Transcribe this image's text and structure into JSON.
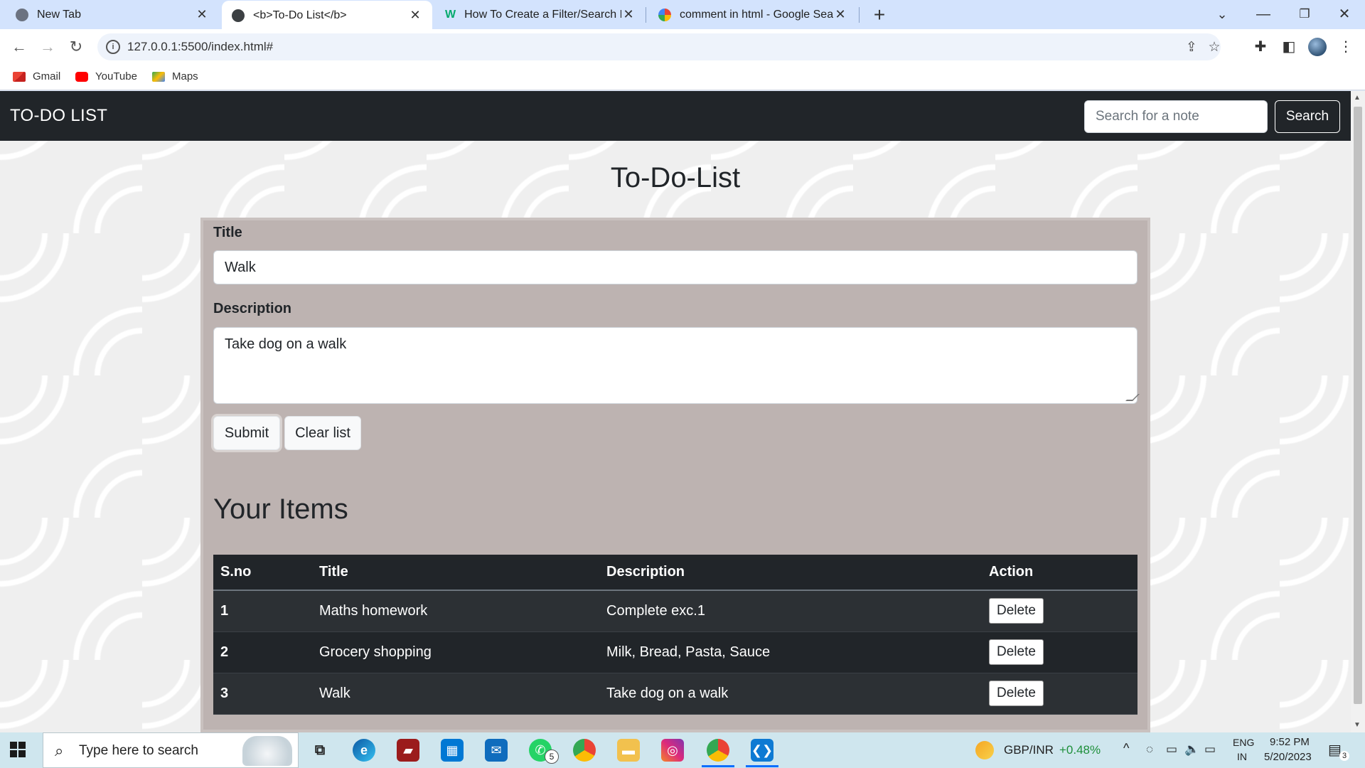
{
  "browser": {
    "tabs": [
      {
        "title": "New Tab",
        "active": false
      },
      {
        "title": "<b>To-Do List</b>",
        "active": true
      },
      {
        "title": "How To Create a Filter/Search Lis",
        "active": false
      },
      {
        "title": "comment in html - Google Searc",
        "active": false
      }
    ],
    "url": "127.0.0.1:5500/index.html#",
    "bookmarks": [
      "Gmail",
      "YouTube",
      "Maps"
    ]
  },
  "navbar": {
    "brand": "TO-DO LIST",
    "search_placeholder": "Search for a note",
    "search_button": "Search"
  },
  "main": {
    "heading": "To-Do-List",
    "title_label": "Title",
    "title_value": "Walk",
    "description_label": "Description",
    "description_value": "Take dog on a walk",
    "submit_label": "Submit",
    "clear_label": "Clear list",
    "items_heading": "Your Items"
  },
  "table": {
    "headers": [
      "S.no",
      "Title",
      "Description",
      "Action"
    ],
    "rows": [
      {
        "sno": "1",
        "title": "Maths homework",
        "description": "Complete exc.1",
        "action": "Delete"
      },
      {
        "sno": "2",
        "title": "Grocery shopping",
        "description": "Milk, Bread, Pasta, Sauce",
        "action": "Delete"
      },
      {
        "sno": "3",
        "title": "Walk",
        "description": "Take dog on a walk",
        "action": "Delete"
      }
    ]
  },
  "taskbar": {
    "search_text": "Type here to search",
    "whatsapp_badge": "5",
    "ticker_label": "GBP/INR",
    "ticker_change": "+0.48%",
    "lang_top": "ENG",
    "lang_bottom": "IN",
    "time": "9:52 PM",
    "date": "5/20/2023",
    "notification_count": "3"
  },
  "colors": {
    "navbar_bg": "#212529",
    "card_bg": "#bdb3b1",
    "ticker_positive": "#1e8f3a",
    "tab_strip": "#d3e3fd"
  }
}
